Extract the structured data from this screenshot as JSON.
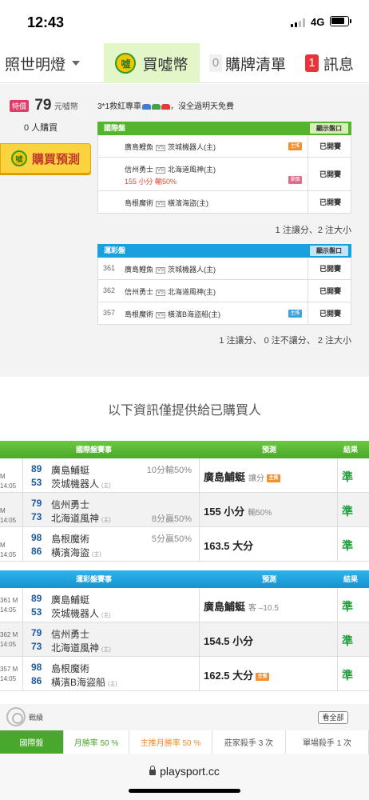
{
  "status_bar": {
    "time": "12:43",
    "network": "4G"
  },
  "nav": {
    "left_label": "照世明燈",
    "buy_coin_label": "買噓幣",
    "coin_glyph": "噓",
    "cart_count": "0",
    "cart_label": "購牌清單",
    "msg_count": "1",
    "msg_label": "訊息"
  },
  "purchase": {
    "tag": "特價",
    "price": "79",
    "unit": "元噓幣",
    "buyers": "0 人購買",
    "buy_button": "購買預測",
    "promo_text": "3*1救紅專車",
    "promo_suffix": "，沒全過明天免費"
  },
  "intl_market": {
    "title": "國際盤",
    "show_button": "顯示盤口",
    "rows": [
      {
        "no": "",
        "away": "廣島鯉魚",
        "vs": "VS",
        "home": "茨城機器人(主)",
        "badge": "主推",
        "status": "已開賽"
      },
      {
        "no": "",
        "away": "信州勇士",
        "vs": "VS",
        "home": "北海道風神(主)",
        "pick": "155 小分  輸50%",
        "badge": "單價",
        "status": "已開賽"
      },
      {
        "no": "",
        "away": "島根魔術",
        "vs": "VS",
        "home": "橫濱海盜(主)",
        "badge": "",
        "status": "已開賽"
      }
    ],
    "summary": "1 注讓分、2 注大小"
  },
  "lottery_market": {
    "title": "運彩盤",
    "show_button": "顯示盤口",
    "rows": [
      {
        "no": "361",
        "away": "廣島鯉魚",
        "vs": "VS",
        "home": "茨城機器人(主)",
        "badge": "",
        "status": "已開賽"
      },
      {
        "no": "362",
        "away": "信州勇士",
        "vs": "VS",
        "home": "北海道風神(主)",
        "badge": "",
        "status": "已開賽"
      },
      {
        "no": "357",
        "away": "島根魔術",
        "vs": "VS",
        "home": "橫濱B海盜船(主)",
        "badge": "主推",
        "status": "已開賽"
      }
    ],
    "summary": "1 注讓分、 0 注不讓分、 2 注大小"
  },
  "notice": "以下資訊僅提供給已購買人",
  "intl_table": {
    "header": "國際盤賽事",
    "pred_header": "預測",
    "result_header": "結果",
    "rows": [
      {
        "time": "M 14:05",
        "n1": "89",
        "t1": "廣島鯆蜓",
        "n2": "53",
        "t2": "茨城機器人",
        "home_mark": "(主)",
        "hc": "10分輸50%",
        "hc_row": 1,
        "pred": "廣島鯆蜓",
        "pred_note": "讓分",
        "badge": "主推",
        "result": "準"
      },
      {
        "time": "M 14:05",
        "n1": "79",
        "t1": "信州勇士",
        "n2": "73",
        "t2": "北海道風神",
        "home_mark": "(主)",
        "hc": "8分贏50%",
        "hc_row": 2,
        "pred": "155 小分",
        "pred_note": "輸50%",
        "badge": "",
        "result": "準"
      },
      {
        "time": "M 14:05",
        "n1": "98",
        "t1": "島根魔術",
        "n2": "86",
        "t2": "橫濱海盜",
        "home_mark": "(主)",
        "hc": "5分贏50%",
        "hc_row": 1,
        "pred": "163.5 大分",
        "pred_note": "",
        "badge": "",
        "result": "準"
      }
    ]
  },
  "lottery_table": {
    "header": "運彩盤賽事",
    "pred_header": "預測",
    "result_header": "結果",
    "rows": [
      {
        "time": "361 M 14:05",
        "n1": "89",
        "t1": "廣島鯆蜓",
        "n2": "53",
        "t2": "茨城機器人",
        "home_mark": "(主)",
        "hc": "",
        "pred": "廣島鯆蜓",
        "pred_note": "客 –10.5",
        "badge": "",
        "result": "準"
      },
      {
        "time": "362 M 14:05",
        "n1": "79",
        "t1": "信州勇士",
        "n2": "73",
        "t2": "北海道風神",
        "home_mark": "(主)",
        "hc": "",
        "pred": "154.5 小分",
        "pred_note": "",
        "badge": "",
        "result": "準"
      },
      {
        "time": "357 M 14:05",
        "n1": "98",
        "t1": "島根魔術",
        "n2": "86",
        "t2": "橫濱B海盜船",
        "home_mark": "(主)",
        "hc": "",
        "pred": "162.5 大分",
        "pred_note": "",
        "badge": "主推",
        "result": "準"
      }
    ]
  },
  "record": {
    "label": "戰績",
    "view_all": "看全部",
    "stats": [
      "國際盤",
      "月勝率 50 %",
      "主推月勝率 50 %",
      "莊家殺手 3 次",
      "單場殺手 1 次"
    ]
  },
  "browser": {
    "url": "playsport.cc"
  },
  "colors": {
    "green": "#54b42d",
    "blue": "#1aa0dc",
    "coin": "#f6c400",
    "red": "#e8333a"
  }
}
